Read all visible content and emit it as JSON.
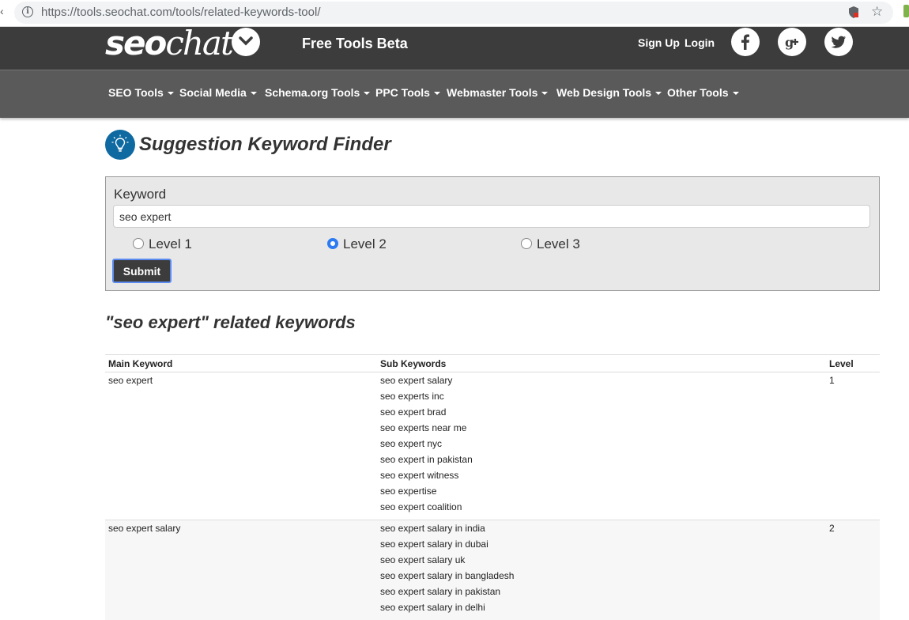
{
  "browser": {
    "url": "https://tools.seochat.com/tools/related-keywords-tool/"
  },
  "header": {
    "logo_bold": "seo",
    "logo_thin": "chat",
    "tagline": "Free Tools Beta",
    "sign_up": "Sign Up",
    "login": "Login",
    "social": {
      "facebook": "f",
      "google_plus": "g+",
      "twitter": "twitter"
    }
  },
  "nav": {
    "items": [
      {
        "label": "SEO Tools"
      },
      {
        "label": "Social Media"
      },
      {
        "label": "Schema.org Tools"
      },
      {
        "label": "PPC Tools"
      },
      {
        "label": "Webmaster Tools"
      },
      {
        "label": "Web Design Tools"
      },
      {
        "label": "Other Tools"
      }
    ]
  },
  "tool": {
    "title": "Suggestion Keyword Finder"
  },
  "form": {
    "keyword_label": "Keyword",
    "keyword_value": "seo expert",
    "levels": [
      {
        "label": "Level 1",
        "checked": false
      },
      {
        "label": "Level 2",
        "checked": true
      },
      {
        "label": "Level 3",
        "checked": false
      }
    ],
    "submit_label": "Submit"
  },
  "results": {
    "heading": "\"seo expert\" related keywords",
    "columns": {
      "main": "Main Keyword",
      "sub": "Sub Keywords",
      "level": "Level"
    },
    "rows": [
      {
        "main": "seo expert",
        "level": "1",
        "subs": [
          "seo expert salary",
          "seo experts inc",
          "seo expert brad",
          "seo experts near me",
          "seo expert nyc",
          "seo expert in pakistan",
          "seo expert witness",
          "seo expertise",
          "seo expert coalition"
        ]
      },
      {
        "main": "seo expert salary",
        "level": "2",
        "subs": [
          "seo expert salary in india",
          "seo expert salary in dubai",
          "seo expert salary uk",
          "seo expert salary in bangladesh",
          "seo expert salary in pakistan",
          "seo expert salary in delhi"
        ]
      }
    ]
  }
}
